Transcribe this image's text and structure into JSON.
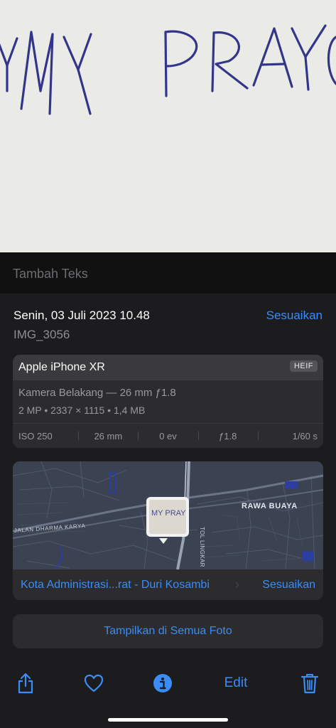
{
  "photo": {
    "handwritten_text": "MY PRAY",
    "ink_color": "#33358a",
    "paper_color": "#ededea"
  },
  "caption": {
    "placeholder": "Tambah Teks",
    "value": ""
  },
  "info": {
    "date": "Senin, 03 Juli 2023 10.48",
    "adjust_label": "Sesuaikan",
    "filename": "IMG_3056"
  },
  "camera": {
    "device": "Apple iPhone XR",
    "format": "HEIF",
    "lens": "Kamera Belakang — 26 mm ƒ1.8",
    "specs": "2 MP  •  2337 × 1115  •  1,4 MB",
    "exif": {
      "iso": "ISO 250",
      "focal_length": "26 mm",
      "exposure_bias": "0 ev",
      "aperture": "ƒ1.8",
      "shutter": "1/60 s"
    }
  },
  "map": {
    "labels": {
      "district": "RAWA BUAYA",
      "street_1": "JALAN DHARMA KARYA",
      "street_2": "TOL LINGKAR"
    },
    "location_name": "Kota Administrasi...rat - Duri Kosambi",
    "adjust_label": "Sesuaikan"
  },
  "show_all_label": "Tampilkan di Semua Foto",
  "toolbar": {
    "share_icon": "share-icon",
    "favorite_icon": "heart-icon",
    "info_icon": "info-icon",
    "edit_label": "Edit",
    "delete_icon": "trash-icon"
  },
  "colors": {
    "accent": "#3b8cf5",
    "panel": "#1c1c1e",
    "card": "#2c2c2e",
    "secondary_text": "#8e8e93"
  }
}
